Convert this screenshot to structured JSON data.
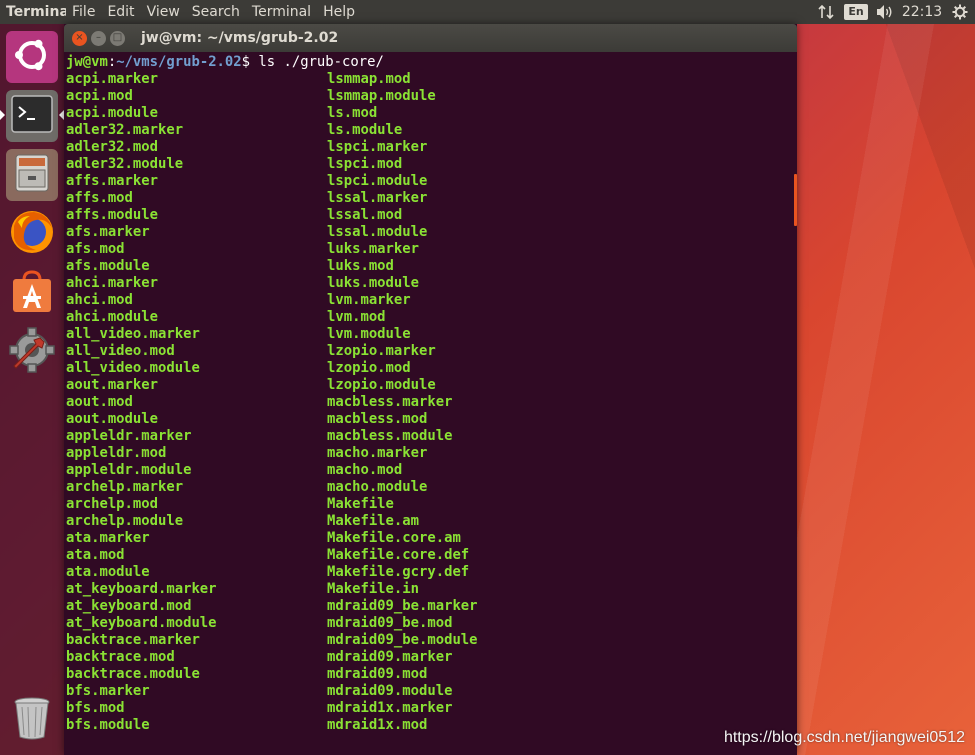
{
  "top_panel": {
    "app_title": "Terminal",
    "menu": [
      "Terminal",
      "File",
      "Edit",
      "View",
      "Search",
      "Terminal",
      "Help"
    ],
    "tray": {
      "network_icon": "network-arrows-icon",
      "keyboard_layout": "En",
      "volume_icon": "volume-icon",
      "clock": "22:13",
      "settings_icon": "gear-icon"
    }
  },
  "launcher": {
    "items": [
      {
        "name": "ubuntu-dash",
        "icon": "ubuntu-logo-icon"
      },
      {
        "name": "terminal",
        "icon": "terminal-icon",
        "active": true
      },
      {
        "name": "files",
        "icon": "file-cabinet-icon"
      },
      {
        "name": "firefox",
        "icon": "firefox-icon"
      },
      {
        "name": "software-center",
        "icon": "shopping-bag-icon"
      },
      {
        "name": "system-settings",
        "icon": "settings-wrench-icon"
      }
    ],
    "trash_icon": "trash-icon"
  },
  "window": {
    "title": "jw@vm: ~/vms/grub-2.02",
    "close": "×",
    "minimize": "–",
    "maximize": "□"
  },
  "terminal": {
    "prompt_user": "jw@vm",
    "prompt_sep": ":",
    "prompt_path": "~/vms/grub-2.02",
    "prompt_symbol": "$ ",
    "command": "ls ./grub-core/",
    "col1": [
      "acpi.marker",
      "acpi.mod",
      "acpi.module",
      "adler32.marker",
      "adler32.mod",
      "adler32.module",
      "affs.marker",
      "affs.mod",
      "affs.module",
      "afs.marker",
      "afs.mod",
      "afs.module",
      "ahci.marker",
      "ahci.mod",
      "ahci.module",
      "all_video.marker",
      "all_video.mod",
      "all_video.module",
      "aout.marker",
      "aout.mod",
      "aout.module",
      "appleldr.marker",
      "appleldr.mod",
      "appleldr.module",
      "archelp.marker",
      "archelp.mod",
      "archelp.module",
      "ata.marker",
      "ata.mod",
      "ata.module",
      "at_keyboard.marker",
      "at_keyboard.mod",
      "at_keyboard.module",
      "backtrace.marker",
      "backtrace.mod",
      "backtrace.module",
      "bfs.marker",
      "bfs.mod",
      "bfs.module"
    ],
    "col2": [
      "lsmmap.mod",
      "lsmmap.module",
      "ls.mod",
      "ls.module",
      "lspci.marker",
      "lspci.mod",
      "lspci.module",
      "lssal.marker",
      "lssal.mod",
      "lssal.module",
      "luks.marker",
      "luks.mod",
      "luks.module",
      "lvm.marker",
      "lvm.mod",
      "lvm.module",
      "lzopio.marker",
      "lzopio.mod",
      "lzopio.module",
      "macbless.marker",
      "macbless.mod",
      "macbless.module",
      "macho.marker",
      "macho.mod",
      "macho.module",
      "Makefile",
      "Makefile.am",
      "Makefile.core.am",
      "Makefile.core.def",
      "Makefile.gcry.def",
      "Makefile.in",
      "mdraid09_be.marker",
      "mdraid09_be.mod",
      "mdraid09_be.module",
      "mdraid09.marker",
      "mdraid09.mod",
      "mdraid09.module",
      "mdraid1x.marker",
      "mdraid1x.mod"
    ]
  },
  "watermark": "https://blog.csdn.net/jiangwei0512",
  "colors": {
    "terminal_bg": "#300a24",
    "file_text": "#8ae234",
    "path_text": "#729fcf",
    "panel_bg": "#3c3b37",
    "accent": "#e95420"
  }
}
